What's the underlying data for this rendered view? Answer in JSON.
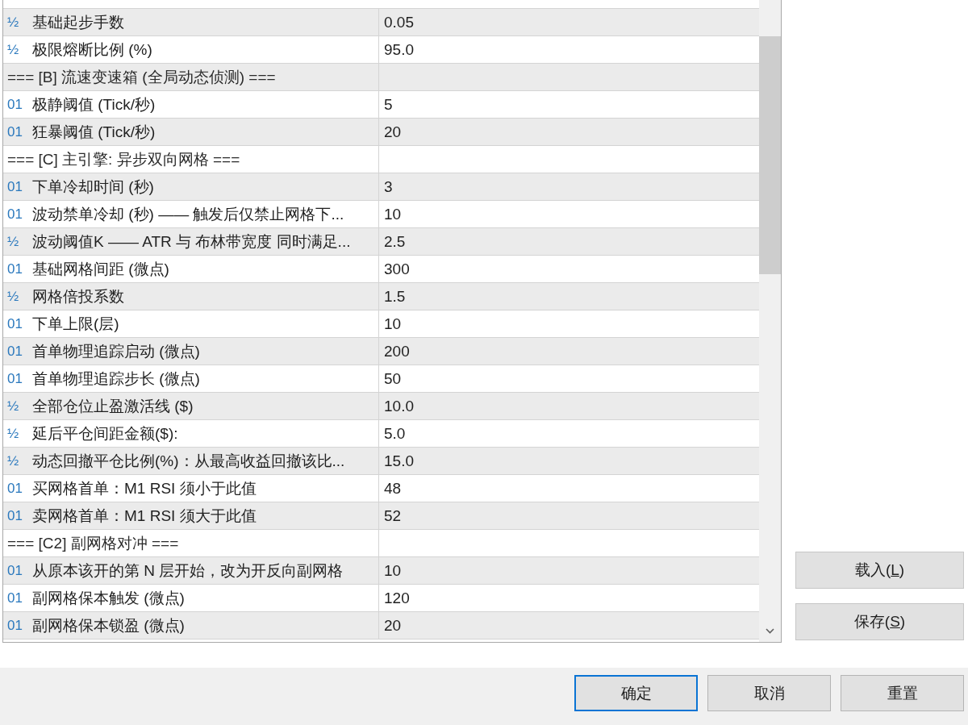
{
  "parameters": {
    "rows": [
      {
        "kind": "param",
        "icon": "½",
        "name": "基础起步手数",
        "value": "0.05"
      },
      {
        "kind": "param",
        "icon": "½",
        "name": "极限熔断比例 (%)",
        "value": "95.0"
      },
      {
        "kind": "section",
        "name": "=== [B] 流速变速箱 (全局动态侦测) ==="
      },
      {
        "kind": "param",
        "icon": "01",
        "name": "极静阈值 (Tick/秒)",
        "value": "5"
      },
      {
        "kind": "param",
        "icon": "01",
        "name": "狂暴阈值 (Tick/秒)",
        "value": "20"
      },
      {
        "kind": "section",
        "name": "=== [C] 主引擎: 异步双向网格 ==="
      },
      {
        "kind": "param",
        "icon": "01",
        "name": "下单冷却时间 (秒)",
        "value": "3"
      },
      {
        "kind": "param",
        "icon": "01",
        "name": "波动禁单冷却 (秒) —— 触发后仅禁止网格下...",
        "value": "10"
      },
      {
        "kind": "param",
        "icon": "½",
        "name": "波动阈值K —— ATR 与 布林带宽度 同时满足...",
        "value": "2.5"
      },
      {
        "kind": "param",
        "icon": "01",
        "name": "基础网格间距 (微点)",
        "value": "300"
      },
      {
        "kind": "param",
        "icon": "½",
        "name": "网格倍投系数",
        "value": "1.5"
      },
      {
        "kind": "param",
        "icon": "01",
        "name": "下单上限(层)",
        "value": "10"
      },
      {
        "kind": "param",
        "icon": "01",
        "name": "首单物理追踪启动 (微点)",
        "value": "200"
      },
      {
        "kind": "param",
        "icon": "01",
        "name": "首单物理追踪步长 (微点)",
        "value": "50"
      },
      {
        "kind": "param",
        "icon": "½",
        "name": "全部仓位止盈激活线 ($)",
        "value": "10.0"
      },
      {
        "kind": "param",
        "icon": "½",
        "name": "延后平仓间距金额($):",
        "value": "5.0"
      },
      {
        "kind": "param",
        "icon": "½",
        "name": "动态回撤平仓比例(%)：从最高收益回撤该比...",
        "value": "15.0"
      },
      {
        "kind": "param",
        "icon": "01",
        "name": "买网格首单：M1 RSI 须小于此值",
        "value": "48"
      },
      {
        "kind": "param",
        "icon": "01",
        "name": "卖网格首单：M1 RSI 须大于此值",
        "value": "52"
      },
      {
        "kind": "section",
        "name": "=== [C2] 副网格对冲 ==="
      },
      {
        "kind": "param",
        "icon": "01",
        "name": "从原本该开的第 N 层开始，改为开反向副网格",
        "value": "10"
      },
      {
        "kind": "param",
        "icon": "01",
        "name": "副网格保本触发 (微点)",
        "value": "120"
      },
      {
        "kind": "param",
        "icon": "01",
        "name": "副网格保本锁盈 (微点)",
        "value": "20"
      }
    ]
  },
  "side_buttons": [
    {
      "label_before": "载入(",
      "accesskey": "L",
      "label_after": ")"
    },
    {
      "label_before": "保存(",
      "accesskey": "S",
      "label_after": ")"
    }
  ],
  "dialog_buttons": [
    {
      "label": "确定",
      "default": true
    },
    {
      "label": "取消",
      "default": false
    },
    {
      "label": "重置",
      "default": false
    }
  ]
}
